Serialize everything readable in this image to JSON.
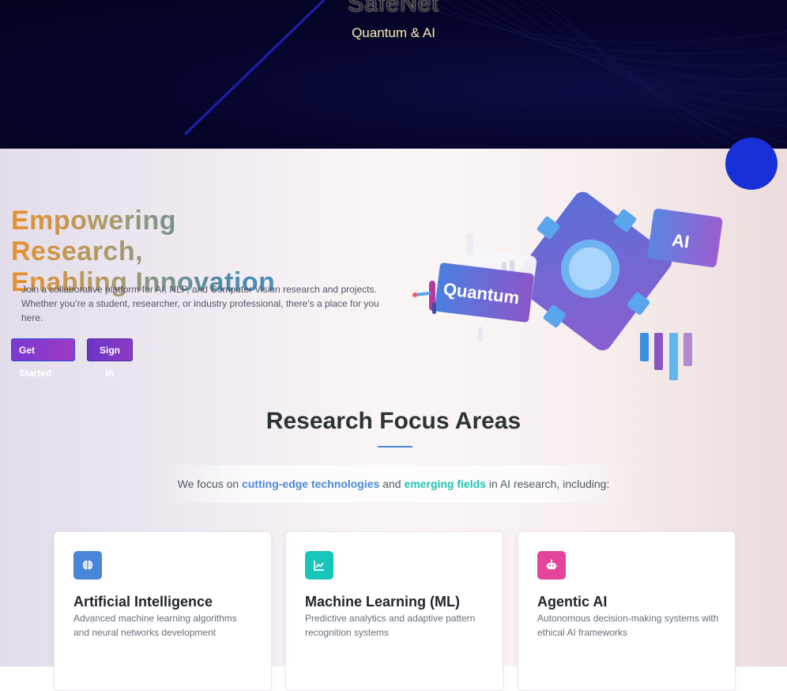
{
  "banner": {
    "title": "SafeNet",
    "subtitle": "Quantum & AI"
  },
  "hero": {
    "title_line1": "Empowering Research,",
    "title_line2": "Enabling Innovation",
    "description": "Join a collaborative platform for AI, NLP, and Computer Vision research and projects. Whether you’re a student, researcher, or industry professional, there’s a place for you here.",
    "get_started_label": "Get Started",
    "sign_in_label": "Sign In",
    "illustration": {
      "quantum_label": "Quantum",
      "ai_label": "AI"
    }
  },
  "focus": {
    "title": "Research Focus Areas",
    "intro_before": "We focus on ",
    "intro_highlight1": "cutting-edge technologies",
    "intro_middle": " and ",
    "intro_highlight2": "emerging fields",
    "intro_after": " in AI research, including:",
    "cards": [
      {
        "title": "Artificial Intelligence",
        "description": "Advanced machine learning algorithms and neural networks development",
        "icon": "brain-icon",
        "color": "#4a86d8"
      },
      {
        "title": "Machine Learning (ML)",
        "description": "Predictive analytics and adaptive pattern recognition systems",
        "icon": "chart-line-icon",
        "color": "#17c6b8"
      },
      {
        "title": "Agentic AI",
        "description": "Autonomous decision-making systems with ethical AI frameworks",
        "icon": "robot-icon",
        "color": "#e2459a"
      }
    ]
  },
  "colors": {
    "banner_bg": "#05052b",
    "accent_orange": "#e8922a",
    "accent_blue": "#4a86d8",
    "accent_teal": "#1fc3b1",
    "button_purple": "#7a3ad0"
  }
}
